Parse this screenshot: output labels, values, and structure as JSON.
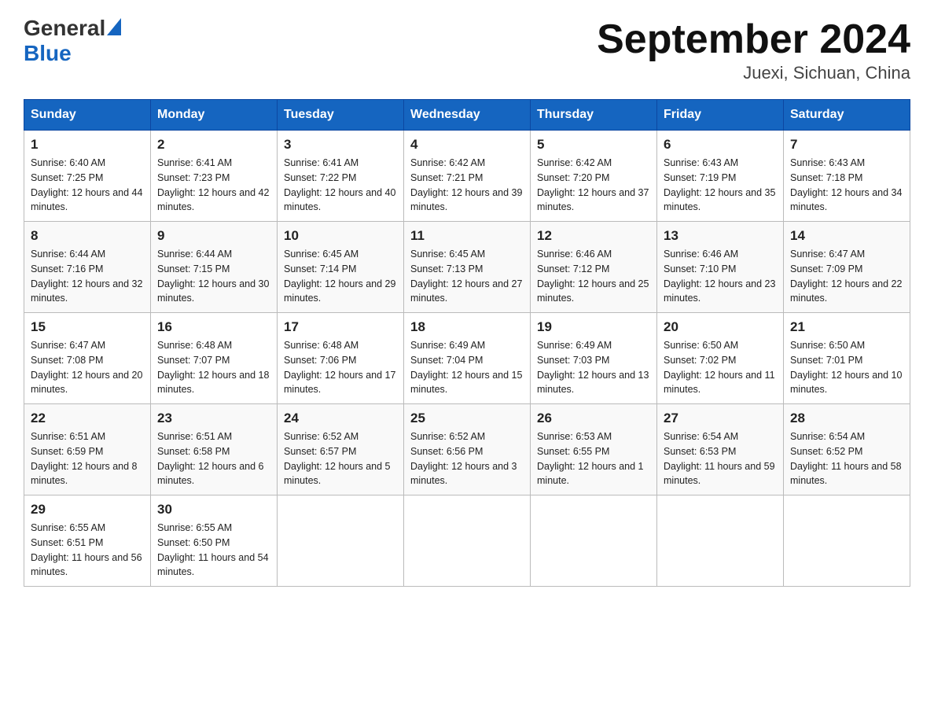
{
  "header": {
    "logo_general": "General",
    "logo_blue": "Blue",
    "title": "September 2024",
    "subtitle": "Juexi, Sichuan, China"
  },
  "days_of_week": [
    "Sunday",
    "Monday",
    "Tuesday",
    "Wednesday",
    "Thursday",
    "Friday",
    "Saturday"
  ],
  "weeks": [
    [
      {
        "day": "1",
        "sunrise": "6:40 AM",
        "sunset": "7:25 PM",
        "daylight": "12 hours and 44 minutes."
      },
      {
        "day": "2",
        "sunrise": "6:41 AM",
        "sunset": "7:23 PM",
        "daylight": "12 hours and 42 minutes."
      },
      {
        "day": "3",
        "sunrise": "6:41 AM",
        "sunset": "7:22 PM",
        "daylight": "12 hours and 40 minutes."
      },
      {
        "day": "4",
        "sunrise": "6:42 AM",
        "sunset": "7:21 PM",
        "daylight": "12 hours and 39 minutes."
      },
      {
        "day": "5",
        "sunrise": "6:42 AM",
        "sunset": "7:20 PM",
        "daylight": "12 hours and 37 minutes."
      },
      {
        "day": "6",
        "sunrise": "6:43 AM",
        "sunset": "7:19 PM",
        "daylight": "12 hours and 35 minutes."
      },
      {
        "day": "7",
        "sunrise": "6:43 AM",
        "sunset": "7:18 PM",
        "daylight": "12 hours and 34 minutes."
      }
    ],
    [
      {
        "day": "8",
        "sunrise": "6:44 AM",
        "sunset": "7:16 PM",
        "daylight": "12 hours and 32 minutes."
      },
      {
        "day": "9",
        "sunrise": "6:44 AM",
        "sunset": "7:15 PM",
        "daylight": "12 hours and 30 minutes."
      },
      {
        "day": "10",
        "sunrise": "6:45 AM",
        "sunset": "7:14 PM",
        "daylight": "12 hours and 29 minutes."
      },
      {
        "day": "11",
        "sunrise": "6:45 AM",
        "sunset": "7:13 PM",
        "daylight": "12 hours and 27 minutes."
      },
      {
        "day": "12",
        "sunrise": "6:46 AM",
        "sunset": "7:12 PM",
        "daylight": "12 hours and 25 minutes."
      },
      {
        "day": "13",
        "sunrise": "6:46 AM",
        "sunset": "7:10 PM",
        "daylight": "12 hours and 23 minutes."
      },
      {
        "day": "14",
        "sunrise": "6:47 AM",
        "sunset": "7:09 PM",
        "daylight": "12 hours and 22 minutes."
      }
    ],
    [
      {
        "day": "15",
        "sunrise": "6:47 AM",
        "sunset": "7:08 PM",
        "daylight": "12 hours and 20 minutes."
      },
      {
        "day": "16",
        "sunrise": "6:48 AM",
        "sunset": "7:07 PM",
        "daylight": "12 hours and 18 minutes."
      },
      {
        "day": "17",
        "sunrise": "6:48 AM",
        "sunset": "7:06 PM",
        "daylight": "12 hours and 17 minutes."
      },
      {
        "day": "18",
        "sunrise": "6:49 AM",
        "sunset": "7:04 PM",
        "daylight": "12 hours and 15 minutes."
      },
      {
        "day": "19",
        "sunrise": "6:49 AM",
        "sunset": "7:03 PM",
        "daylight": "12 hours and 13 minutes."
      },
      {
        "day": "20",
        "sunrise": "6:50 AM",
        "sunset": "7:02 PM",
        "daylight": "12 hours and 11 minutes."
      },
      {
        "day": "21",
        "sunrise": "6:50 AM",
        "sunset": "7:01 PM",
        "daylight": "12 hours and 10 minutes."
      }
    ],
    [
      {
        "day": "22",
        "sunrise": "6:51 AM",
        "sunset": "6:59 PM",
        "daylight": "12 hours and 8 minutes."
      },
      {
        "day": "23",
        "sunrise": "6:51 AM",
        "sunset": "6:58 PM",
        "daylight": "12 hours and 6 minutes."
      },
      {
        "day": "24",
        "sunrise": "6:52 AM",
        "sunset": "6:57 PM",
        "daylight": "12 hours and 5 minutes."
      },
      {
        "day": "25",
        "sunrise": "6:52 AM",
        "sunset": "6:56 PM",
        "daylight": "12 hours and 3 minutes."
      },
      {
        "day": "26",
        "sunrise": "6:53 AM",
        "sunset": "6:55 PM",
        "daylight": "12 hours and 1 minute."
      },
      {
        "day": "27",
        "sunrise": "6:54 AM",
        "sunset": "6:53 PM",
        "daylight": "11 hours and 59 minutes."
      },
      {
        "day": "28",
        "sunrise": "6:54 AM",
        "sunset": "6:52 PM",
        "daylight": "11 hours and 58 minutes."
      }
    ],
    [
      {
        "day": "29",
        "sunrise": "6:55 AM",
        "sunset": "6:51 PM",
        "daylight": "11 hours and 56 minutes."
      },
      {
        "day": "30",
        "sunrise": "6:55 AM",
        "sunset": "6:50 PM",
        "daylight": "11 hours and 54 minutes."
      },
      null,
      null,
      null,
      null,
      null
    ]
  ]
}
